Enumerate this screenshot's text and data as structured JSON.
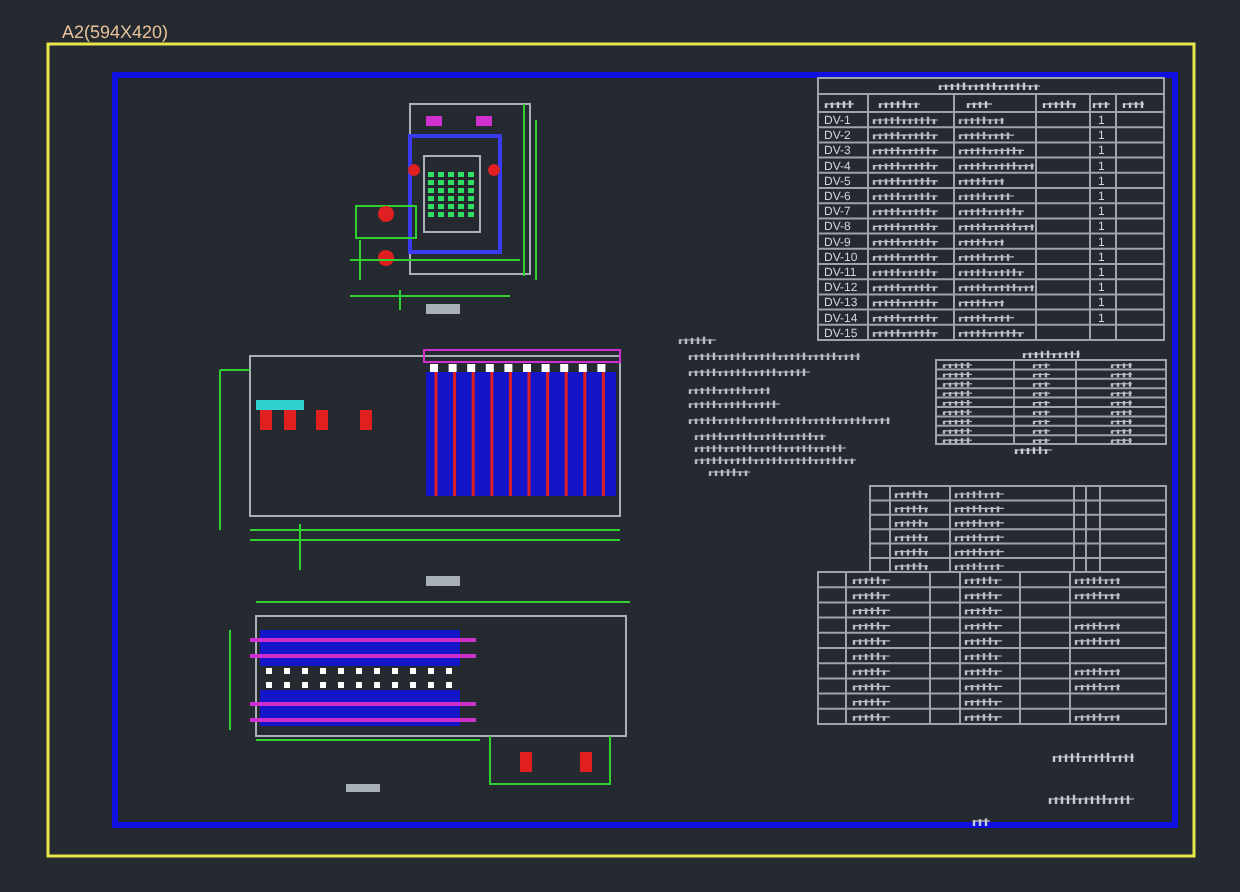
{
  "sheet": {
    "title": "A2(594X420)"
  },
  "parts_table": {
    "rows": [
      {
        "code": "DV-1",
        "quantity": "1"
      },
      {
        "code": "DV-2",
        "quantity": "1"
      },
      {
        "code": "DV-3",
        "quantity": "1"
      },
      {
        "code": "DV-4",
        "quantity": "1"
      },
      {
        "code": "DV-5",
        "quantity": "1"
      },
      {
        "code": "DV-6",
        "quantity": "1"
      },
      {
        "code": "DV-7",
        "quantity": "1"
      },
      {
        "code": "DV-8",
        "quantity": "1"
      },
      {
        "code": "DV-9",
        "quantity": "1"
      },
      {
        "code": "DV-10",
        "quantity": "1"
      },
      {
        "code": "DV-11",
        "quantity": "1"
      },
      {
        "code": "DV-12",
        "quantity": "1"
      },
      {
        "code": "DV-13",
        "quantity": "1"
      },
      {
        "code": "DV-14",
        "quantity": "1"
      },
      {
        "code": "DV-15"
      }
    ]
  }
}
